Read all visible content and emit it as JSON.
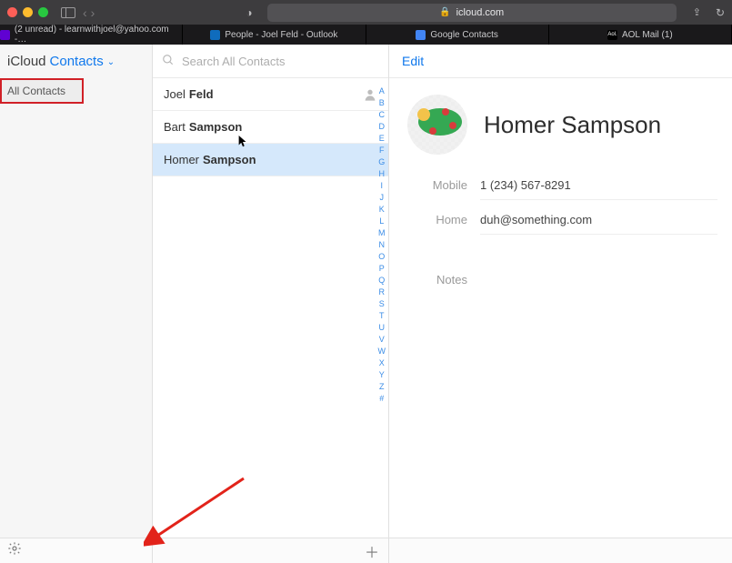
{
  "chrome": {
    "url_host": "icloud.com"
  },
  "tabs": [
    {
      "label": "(2 unread) - learnwithjoel@yahoo.com -…"
    },
    {
      "label": "People - Joel Feld - Outlook"
    },
    {
      "label": "Google Contacts"
    },
    {
      "label": "AOL Mail (1)"
    }
  ],
  "sidebar": {
    "brand_prefix": "iCloud",
    "brand_main": "Contacts",
    "groups": [
      {
        "label": "All Contacts"
      }
    ]
  },
  "search": {
    "placeholder": "Search All Contacts",
    "value": ""
  },
  "contacts": [
    {
      "first": "Joel",
      "last": "Feld",
      "is_me": true,
      "selected": false
    },
    {
      "first": "Bart",
      "last": "Sampson",
      "is_me": false,
      "selected": false
    },
    {
      "first": "Homer",
      "last": "Sampson",
      "is_me": false,
      "selected": true
    }
  ],
  "alpha_index": [
    "A",
    "B",
    "C",
    "D",
    "E",
    "F",
    "G",
    "H",
    "I",
    "J",
    "K",
    "L",
    "M",
    "N",
    "O",
    "P",
    "Q",
    "R",
    "S",
    "T",
    "U",
    "V",
    "W",
    "X",
    "Y",
    "Z",
    "#"
  ],
  "detail": {
    "edit_label": "Edit",
    "display_name": "Homer Sampson",
    "fields": [
      {
        "label": "Mobile",
        "value": "1 (234) 567-8291"
      },
      {
        "label": "Home",
        "value": "duh@something.com"
      },
      {
        "label": "Notes",
        "value": ""
      }
    ]
  }
}
